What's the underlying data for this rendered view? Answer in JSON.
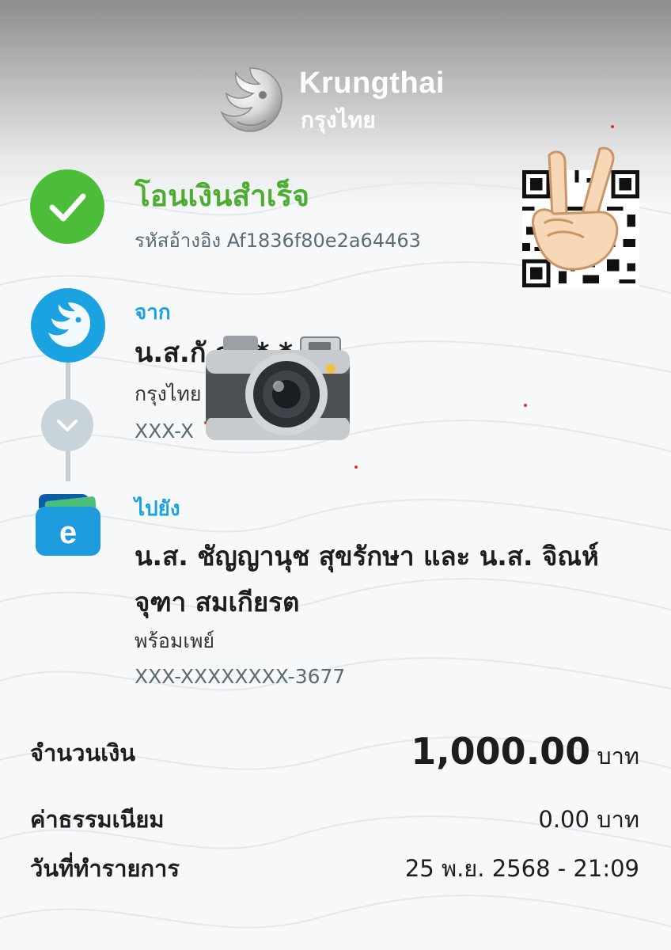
{
  "bank": {
    "name_en": "Krungthai",
    "name_th": "กรุงไทย",
    "logo": "krungthai-bird-logo"
  },
  "status": {
    "title": "โอนเงินสำเร็จ",
    "reference": "รหัสอ้างอิง Af1836f80e2a64463",
    "icon": "check-icon",
    "color": "#4bbd38"
  },
  "qr": {
    "icon": "qr-code-icon",
    "overlay_emoji": "victory-hand-emoji"
  },
  "from": {
    "label": "จาก",
    "name": "น.ส.กั          ส* * *",
    "bank": "กรุงไทย",
    "account": "XXX-X",
    "overlay_emoji": "camera-emoji"
  },
  "to": {
    "label": "ไปยัง",
    "name": "น.ส. ชัญญานุช สุขรักษา และ น.ส. จิณห์จุฑา สมเกียรต",
    "service": "พร้อมเพย์",
    "account": "XXX-XXXXXXXX-3677",
    "icon": "e-wallet-icon"
  },
  "details": {
    "amount_label": "จำนวนเงิน",
    "amount": "1,000.00",
    "amount_unit": "บาท",
    "fee_label": "ค่าธรรมเนียม",
    "fee": "0.00 บาท",
    "date_label": "วันที่ทำรายการ",
    "date": "25 พ.ย. 2568 - 21:09"
  },
  "colors": {
    "accent_blue": "#1ba2e0",
    "success_green": "#4cae30",
    "text_dark": "#1d1d1d",
    "text_muted": "#5b6b74"
  }
}
